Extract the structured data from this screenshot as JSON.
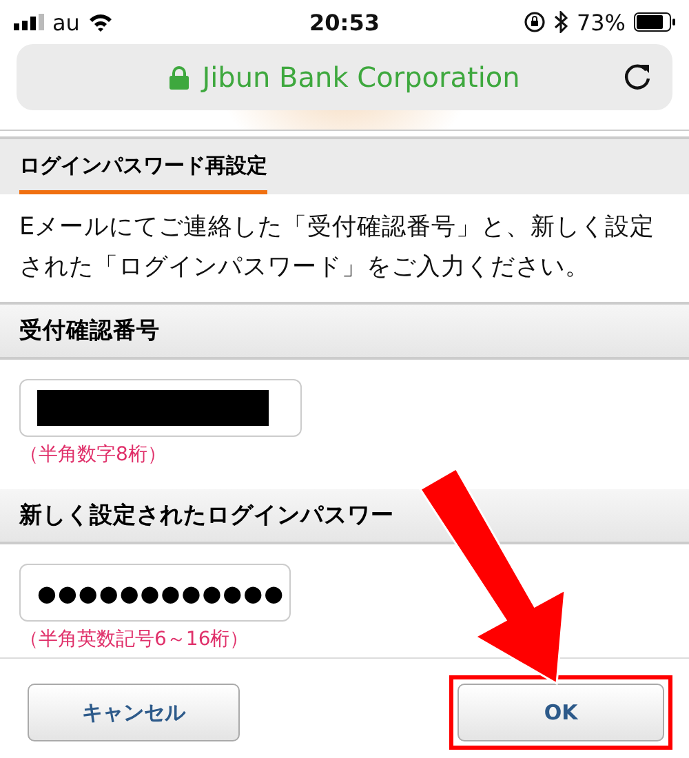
{
  "status_bar": {
    "carrier": "au",
    "time": "20:53",
    "battery": "73%"
  },
  "address_bar": {
    "title": "Jibun Bank Corporation",
    "secure": true
  },
  "tab": {
    "label": "ログインパスワード再設定",
    "selected": true
  },
  "message": "Eメールにてご連絡した「受付確認番号」と、新しく設定された「ログインパスワード」をご入力ください。",
  "sections": [
    {
      "label": "受付確認番号",
      "field": {
        "kind": "redacted"
      },
      "hint": "（半角数字8桁）"
    },
    {
      "label": "新しく設定されたログインパスワー",
      "field": {
        "kind": "password",
        "value": "●●●●●●●●●●●●"
      },
      "hint": "（半角英数記号6～16桁）"
    }
  ],
  "buttons": [
    {
      "label": "キャンセル",
      "highlighted": false
    },
    {
      "label": "OK",
      "highlighted": true
    }
  ]
}
